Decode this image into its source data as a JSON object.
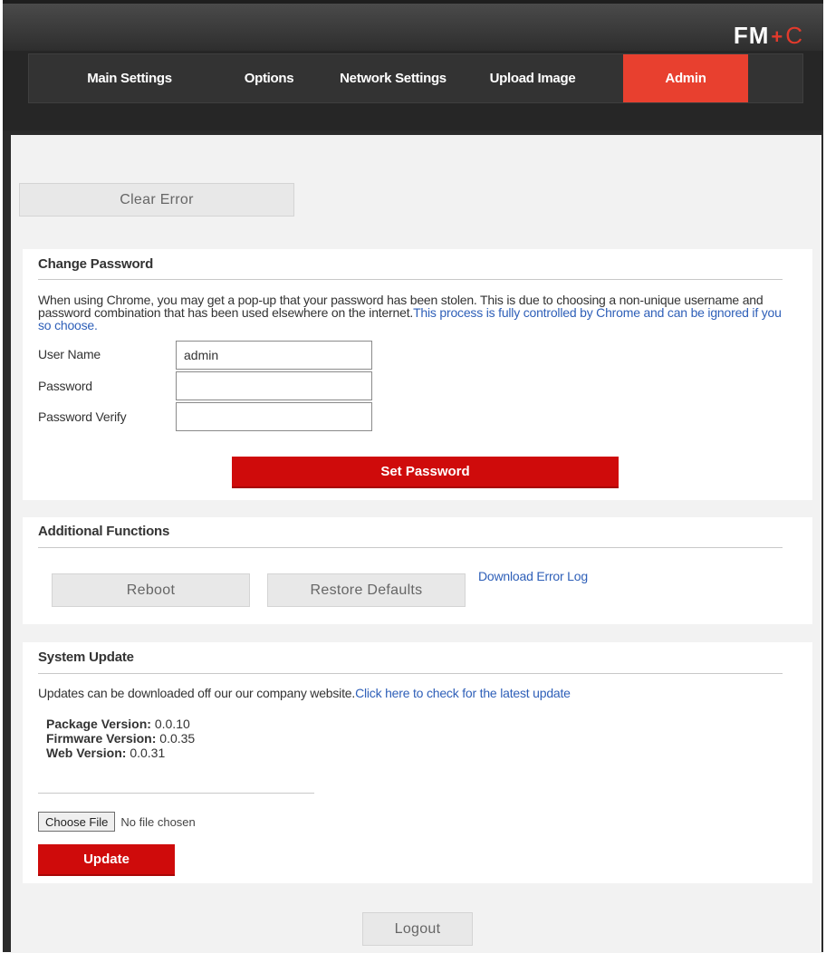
{
  "brand": {
    "fm": "FM",
    "plus": "+",
    "c": "C"
  },
  "nav": {
    "tabs": [
      {
        "label": "Main Settings"
      },
      {
        "label": "Options"
      },
      {
        "label": "Network Settings"
      },
      {
        "label": "Upload Image"
      },
      {
        "label": "Admin",
        "active": true
      }
    ]
  },
  "clear_error_label": "Clear Error",
  "change_password": {
    "title": "Change Password",
    "note": "When using Chrome, you may get a pop-up that your password has been stolen. This is due to choosing a non-unique username and password combination that has been used elsewhere on the internet.",
    "note_link": "This process is fully controlled by Chrome and can be ignored if you so choose.",
    "fields": {
      "username_label": "User Name",
      "username_value": "admin",
      "password_label": "Password",
      "password_value": "",
      "verify_label": "Password Verify",
      "verify_value": ""
    },
    "submit_label": "Set Password"
  },
  "additional": {
    "title": "Additional Functions",
    "reboot_label": "Reboot",
    "restore_label": "Restore Defaults",
    "download_link": "Download Error Log"
  },
  "system_update": {
    "title": "System Update",
    "note": "Updates can be downloaded off our our company website.",
    "note_link": "Click here to check for the latest update",
    "package_label": "Package Version:",
    "package_value": "0.0.10",
    "firmware_label": "Firmware Version:",
    "firmware_value": "0.0.35",
    "web_label": "Web Version:",
    "web_value": "0.0.31",
    "choose_file_label": "Choose File",
    "no_file_text": "No file chosen",
    "update_label": "Update"
  },
  "logout_label": "Logout",
  "colors": {
    "accent": "#e8402f",
    "primary_button": "#cf0b0b",
    "link": "#2e5fb8"
  }
}
